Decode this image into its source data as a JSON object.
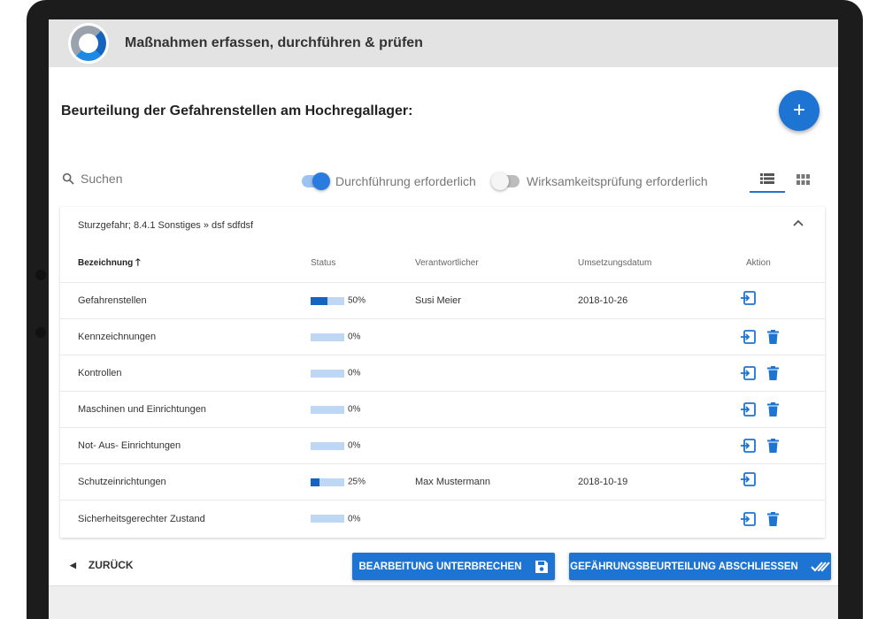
{
  "app": {
    "title": "Maßnahmen erfassen, durchführen & prüfen"
  },
  "page": {
    "title": "Beurteilung der Gefahrenstellen am Hochregallager:"
  },
  "fab": {
    "label": "+"
  },
  "toolbar": {
    "search_placeholder": "Suchen",
    "toggle_durchfuehrung": {
      "label": "Durchführung erforderlich",
      "on": true
    },
    "toggle_wirksamkeit": {
      "label": "Wirksamkeitsprüfung erforderlich",
      "on": false
    },
    "view_active": "list"
  },
  "card": {
    "heading": "Sturzgefahr; 8.4.1 Sonstiges » dsf sdfdsf",
    "columns": {
      "bezeichnung": "Bezeichnung",
      "status": "Status",
      "verantwortlicher": "Verantwortlicher",
      "umsetzungsdatum": "Umsetzungsdatum",
      "aktion": "Aktion"
    },
    "rows": [
      {
        "bezeichnung": "Gefahrenstellen",
        "progress": 50,
        "status": "50%",
        "verantwortlicher": "Susi Meier",
        "datum": "2018-10-26",
        "deletable": false
      },
      {
        "bezeichnung": "Kennzeichnungen",
        "progress": 0,
        "status": "0%",
        "verantwortlicher": "",
        "datum": "",
        "deletable": true
      },
      {
        "bezeichnung": "Kontrollen",
        "progress": 0,
        "status": "0%",
        "verantwortlicher": "",
        "datum": "",
        "deletable": true
      },
      {
        "bezeichnung": "Maschinen und Einrichtungen",
        "progress": 0,
        "status": "0%",
        "verantwortlicher": "",
        "datum": "",
        "deletable": true
      },
      {
        "bezeichnung": "Not- Aus- Einrichtungen",
        "progress": 0,
        "status": "0%",
        "verantwortlicher": "",
        "datum": "",
        "deletable": true
      },
      {
        "bezeichnung": "Schutzeinrichtungen",
        "progress": 25,
        "status": "25%",
        "verantwortlicher": "Max Mustermann",
        "datum": "2018-10-19",
        "deletable": false
      },
      {
        "bezeichnung": "Sicherheitsgerechter Zustand",
        "progress": 0,
        "status": "0%",
        "verantwortlicher": "",
        "datum": "",
        "deletable": true
      }
    ]
  },
  "footer": {
    "back_label": "ZURÜCK",
    "pause_label": "BEARBEITUNG UNTERBRECHEN",
    "finish_label": "GEFÄHRUNGSBEURTEILUNG ABSCHLIESSEN"
  },
  "colors": {
    "primary": "#1e74d2",
    "progress_track": "#bdd7f4",
    "progress_fill": "#1565c0",
    "header_bg": "#e3e3e3"
  }
}
